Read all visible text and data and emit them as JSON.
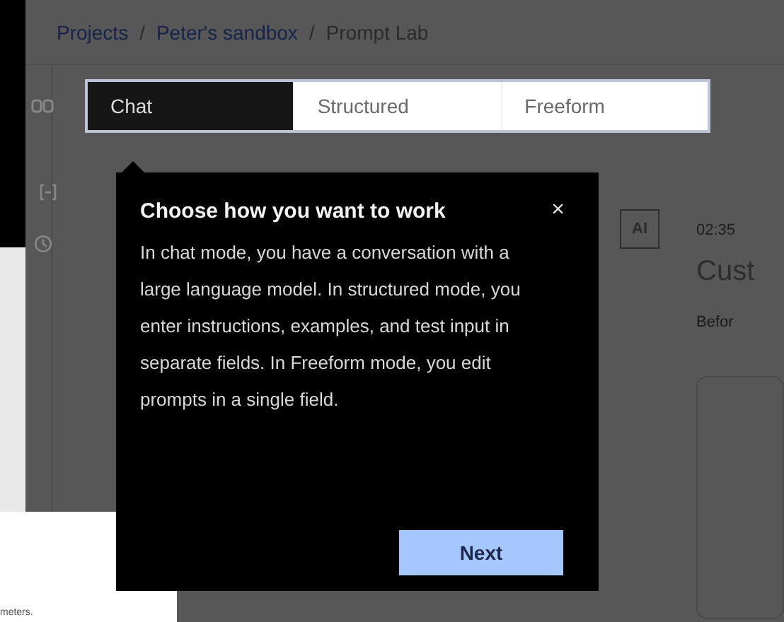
{
  "breadcrumb": [
    {
      "kind": "link",
      "text": "Projects"
    },
    {
      "kind": "separator",
      "text": "/"
    },
    {
      "kind": "link",
      "text": "Peter's sandbox"
    },
    {
      "kind": "separator",
      "text": "/"
    },
    {
      "kind": "current",
      "text": "Prompt Lab"
    }
  ],
  "tabs": [
    {
      "label": "Chat",
      "selected": true
    },
    {
      "label": "Structured",
      "selected": false
    },
    {
      "label": "Freeform",
      "selected": false
    }
  ],
  "popover": {
    "title": "Choose how you want to work",
    "close": "×",
    "body": "In chat mode, you have a conversation with a large language model. In structured mode, you enter instructions, examples, and test input in separate fields. In Freeform mode, you edit prompts in a single field.",
    "button": "Next"
  },
  "message": {
    "avatar": "AI",
    "time": "02:35",
    "title": "Cust",
    "text": "Befor"
  },
  "background_panel": {
    "text": "meters."
  }
}
